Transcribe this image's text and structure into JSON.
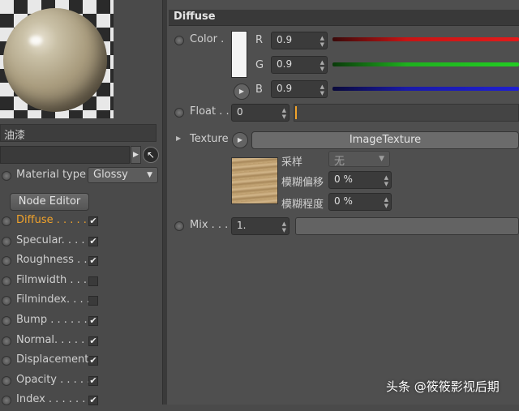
{
  "left": {
    "material_name": "油漆",
    "material_type_label": "Material type",
    "material_type_value": "Glossy",
    "node_editor_label": "Node Editor",
    "channels": [
      {
        "label": "Diffuse . . . . .",
        "checked": true,
        "active": true
      },
      {
        "label": "Specular. . . . .",
        "checked": true,
        "active": false
      },
      {
        "label": "Roughness . .",
        "checked": true,
        "active": false
      },
      {
        "label": "Filmwidth . . .",
        "checked": false,
        "active": false
      },
      {
        "label": "Filmindex. . . .",
        "checked": false,
        "active": false
      },
      {
        "label": "Bump . . . . . . .",
        "checked": true,
        "active": false
      },
      {
        "label": "Normal. . . . . . .",
        "checked": true,
        "active": false
      },
      {
        "label": "Displacement",
        "checked": true,
        "active": false
      },
      {
        "label": "Opacity . . . . .",
        "checked": true,
        "active": false
      },
      {
        "label": "Index . . . . . . .",
        "checked": true,
        "active": false
      }
    ],
    "check_glyph": "✔"
  },
  "right": {
    "section_title": "Diffuse",
    "color_label": "Color .",
    "r_label": "R",
    "r_value": "0.9",
    "g_label": "G",
    "g_value": "0.9",
    "b_label": "B",
    "b_value": "0.9",
    "float_label": "Float . .",
    "float_value": "0",
    "texture_label": "Texture",
    "texture_button": "ImageTexture",
    "sampling_label": "采样",
    "sampling_value": "无",
    "blur_offset_label": "模糊偏移",
    "blur_offset_value": "0 %",
    "blur_degree_label": "模糊程度",
    "blur_degree_value": "0 %",
    "mix_label": "Mix . . .",
    "mix_value": "1."
  },
  "watermark": "头条 @筱筱影视后期",
  "colors": {
    "active_channel": "#f0a22b",
    "red_slider": "#c81414",
    "green_slider": "#1fb01f",
    "blue_slider": "#1a1aa8",
    "float_marker": "#f0a22b"
  }
}
